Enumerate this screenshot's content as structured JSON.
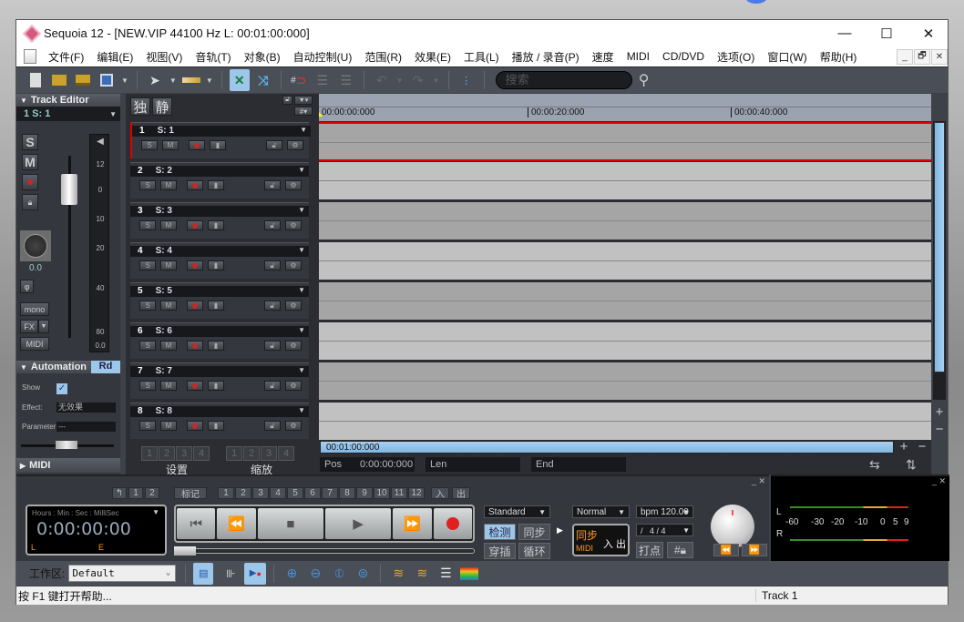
{
  "window": {
    "title": "Sequoia 12 - [NEW.VIP    44100 Hz L: 00:01:00:000]",
    "controls": {
      "minimize": "—",
      "maximize": "☐",
      "close": "✕"
    }
  },
  "menu": {
    "items": [
      "文件(F)",
      "编辑(E)",
      "视图(V)",
      "音轨(T)",
      "对象(B)",
      "自动控制(U)",
      "范围(R)",
      "效果(E)",
      "工具(L)",
      "播放 / 录音(P)",
      "速度",
      "MIDI",
      "CD/DVD",
      "选项(O)",
      "窗口(W)",
      "帮助(H)"
    ],
    "mdi_controls": [
      "_",
      "🗗",
      "✕"
    ]
  },
  "toolbar": {
    "search_placeholder": "搜索",
    "icons": [
      "new-file",
      "open-folder",
      "open-audio",
      "save",
      "pointer",
      "range-bar",
      "crossfade",
      "auto-crossfade",
      "snap-magnet",
      "grid-lines-1",
      "grid-lines-2",
      "undo",
      "redo"
    ]
  },
  "track_editor": {
    "header": "Track Editor",
    "selected_track": "1   S: 1",
    "buttons": {
      "solo": "S",
      "mute": "M",
      "phase": "φ",
      "mono": "mono",
      "fx": "FX",
      "midi": "MIDI"
    },
    "pan_value": "0.0",
    "meter_ticks": [
      "12",
      "0",
      "10",
      "20",
      "40",
      "80"
    ],
    "meter_value": "0.0"
  },
  "automation": {
    "header": "Automation",
    "mode": "Rd",
    "show_label": "Show",
    "show_checked": true,
    "effect_label": "Effect:",
    "effect_value": "无效果",
    "parameter_label": "Parameter",
    "parameter_value": "---"
  },
  "midi_panel": {
    "header": "MIDI"
  },
  "track_header_buttons": {
    "solo_all": "独",
    "mute_all": "静"
  },
  "tracks": [
    {
      "num": "1",
      "name": "S: 1"
    },
    {
      "num": "2",
      "name": "S: 2"
    },
    {
      "num": "3",
      "name": "S: 3"
    },
    {
      "num": "4",
      "name": "S: 4"
    },
    {
      "num": "5",
      "name": "S: 5"
    },
    {
      "num": "6",
      "name": "S: 6"
    },
    {
      "num": "7",
      "name": "S: 7"
    },
    {
      "num": "8",
      "name": "S: 8"
    }
  ],
  "track_btn_labels": {
    "s": "S",
    "m": "M"
  },
  "presets": {
    "setup_label": "设置",
    "zoom_label": "缩放",
    "numbers": [
      "1",
      "2",
      "3",
      "4"
    ]
  },
  "ruler": {
    "marks": [
      "00:00:00:000",
      "00:00:20:000",
      "00:00:40:000"
    ]
  },
  "range_bar": {
    "value": "00:01:00:000"
  },
  "position": {
    "pos_label": "Pos",
    "pos_value": "0:00:00:000",
    "len_label": "Len",
    "end_label": "End"
  },
  "transport": {
    "marker_back": "↰",
    "marker_12": [
      "1",
      "2"
    ],
    "marker_label": "标记",
    "markers": [
      "1",
      "2",
      "3",
      "4",
      "5",
      "6",
      "7",
      "8",
      "9",
      "10",
      "11",
      "12"
    ],
    "in_label": "入",
    "out_label": "出",
    "time_format": "Hours : Min :  Sec : MilliSec",
    "time_value": "0:00:00:00",
    "l_label": "L",
    "e_label": "E",
    "mode": "Standard",
    "btn_detect": "检测",
    "btn_sync": "同步",
    "btn_punch": "穿插",
    "btn_loop": "循环",
    "speed_mode": "Normal",
    "bpm": "bpm 120.00",
    "time_sig": "4 / 4",
    "sync_label": "同步",
    "midi_label": "MIDI",
    "in_out": [
      "入",
      "出"
    ],
    "tap_label": "打点",
    "grid_label": "#"
  },
  "vu_meter": {
    "l": "L",
    "r": "R",
    "scale": [
      "-60",
      "-30",
      "-20",
      "-10",
      "0",
      "5",
      "9"
    ]
  },
  "workspace": {
    "label": "工作区:",
    "value": "Default"
  },
  "status": {
    "help": "按 F1 键打开帮助...",
    "track": "Track 1"
  },
  "colors": {
    "accent": "#9cc7ea",
    "record": "#e02020",
    "orange": "#ff9a1a",
    "selection": "#e00000"
  }
}
